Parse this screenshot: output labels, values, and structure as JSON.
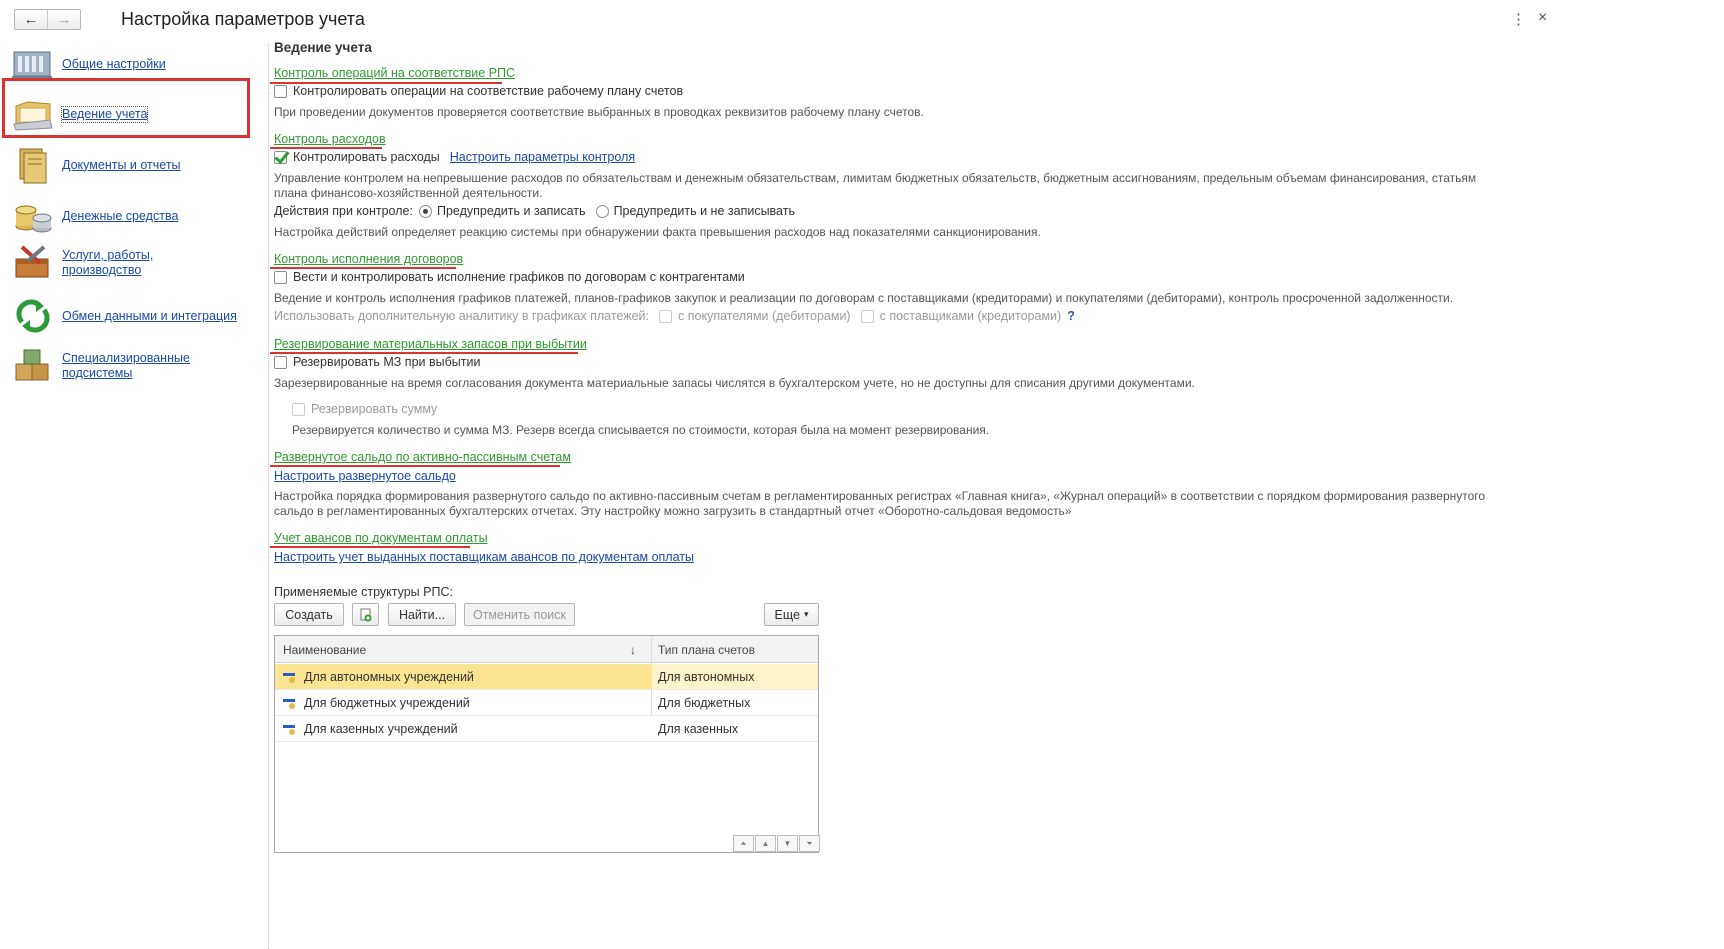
{
  "window": {
    "title": "Настройка параметров учета",
    "back": "←",
    "forward": "→",
    "menu": "⋮",
    "close": "×"
  },
  "sidebar": {
    "items": [
      {
        "label": "Общие настройки",
        "icon": "building-icon"
      },
      {
        "label": "Ведение учета",
        "icon": "folder-icon"
      },
      {
        "label": "Документы и отчеты",
        "icon": "documents-icon"
      },
      {
        "label": "Денежные средства",
        "icon": "coins-icon"
      },
      {
        "label": "Услуги, работы, производство",
        "icon": "toolbox-icon"
      },
      {
        "label": "Обмен данными и интеграция",
        "icon": "exchange-arrows-icon"
      },
      {
        "label": "Специализированные подсистемы",
        "icon": "boxes-icon"
      }
    ]
  },
  "main": {
    "title": "Ведение учета",
    "rps": {
      "header": "Контроль операций на соответствие РПС",
      "checkbox": "Контролировать операции на соответствие рабочему плану счетов",
      "hint": "При проведении документов проверяется соответствие выбранных в проводках реквизитов рабочему плану счетов."
    },
    "expenses": {
      "header": "Контроль расходов",
      "checkbox": "Контролировать расходы",
      "link": "Настроить параметры контроля",
      "hint": "Управление контролем на непревышение расходов по обязательствам и денежным обязательствам, лимитам бюджетных обязательств, бюджетным ассигнованиям, предельным объемам финансирования, статьям плана финансово-хозяйственной деятельности.",
      "actions_label": "Действия при контроле:",
      "radio1": "Предупредить и записать",
      "radio2": "Предупредить и не записывать",
      "actions_hint": "Настройка действий определяет реакцию системы при обнаружении факта превышения расходов над показателями санкционирования."
    },
    "contracts": {
      "header": "Контроль исполнения договоров",
      "checkbox": "Вести и контролировать исполнение графиков по договорам с контрагентами",
      "hint": "Ведение и контроль исполнения графиков платежей, планов-графиков закупок и реализации по договорам с поставщиками (кредиторами) и покупателями (дебиторами), контроль просроченной задолженности.",
      "analytics_label": "Использовать дополнительную аналитику в графиках платежей:",
      "buyers": "с покупателями (дебиторами)",
      "suppliers": "с поставщиками (кредиторами)",
      "help": "?"
    },
    "reserve": {
      "header": "Резервирование материальных запасов при выбытии",
      "checkbox": "Резервировать МЗ при выбытии",
      "hint": "Зарезервированные на время согласования документа материальные запасы числятся в бухгалтерском учете, но не доступны для списания другими документами.",
      "sum_checkbox": "Резервировать сумму",
      "sum_hint": "Резервируется количество и сумма МЗ. Резерв всегда списывается по стоимости, которая была на момент резервирования."
    },
    "balance": {
      "header": "Развернутое сальдо по активно-пассивным счетам",
      "link": "Настроить развернутое сальдо",
      "hint": "Настройка порядка формирования развернутого сальдо по активно-пассивным счетам в регламентированных регистрах «Главная книга», «Журнал операций» в соответствии с порядком формирования развернутого сальдо в регламентированных бухгалтерских отчетах. Эту настройку можно загрузить в стандартный отчет «Оборотно-сальдовая ведомость»"
    },
    "advances": {
      "header": "Учет авансов по документам оплаты",
      "link": "Настроить учет выданных поставщикам авансов по документам оплаты"
    },
    "structures": {
      "label": "Применяемые структуры РПС:",
      "create": "Создать",
      "find": "Найти...",
      "cancel_search": "Отменить поиск",
      "more": "Еще",
      "more_arrow": "▾",
      "columns": [
        "Наименование",
        "Тип плана счетов"
      ],
      "sort_arrow": "↓",
      "rows": [
        {
          "name": "Для автономных учреждений",
          "type": "Для автономных",
          "selected": true
        },
        {
          "name": "Для бюджетных учреждений",
          "type": "Для бюджетных",
          "selected": false
        },
        {
          "name": "Для казенных учреждений",
          "type": "Для казенных",
          "selected": false
        }
      ],
      "scroll_buttons": [
        "⏶",
        "▲",
        "▼",
        "⏷"
      ]
    }
  },
  "colors": {
    "accent_green": "#2f9c2f",
    "link_blue": "#1c4aa8",
    "annotation_red": "#d83434",
    "selected_row": "#fbe592"
  }
}
